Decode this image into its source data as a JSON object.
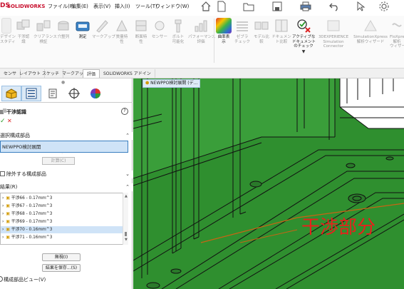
{
  "app": {
    "brand": "DS",
    "name": "SOLIDWORKS"
  },
  "menu": [
    "ファイル(F)",
    "編集(E)",
    "表示(V)",
    "挿入(I)",
    "ツール(T)",
    "ウィンドウ(W)"
  ],
  "ribbon": {
    "left_buttons": [
      {
        "label": "デザイン\nスタディ"
      },
      {
        "label": "干渉認\n識"
      },
      {
        "label": "クリアランス\n検証"
      },
      {
        "label": "穴整列"
      },
      {
        "label": "測定"
      },
      {
        "label": "マークアップ"
      },
      {
        "label": "質量特\n性"
      },
      {
        "label": "断面特\n性"
      },
      {
        "label": "センサー"
      },
      {
        "label": "ボルト\n可能化"
      },
      {
        "label": "パフォーマンス\n評価"
      }
    ],
    "right_buttons": [
      {
        "label": "曲率表\n示"
      },
      {
        "label": "ゼブラ\nチェック"
      },
      {
        "label": "モデル比\n較"
      },
      {
        "label": "ドキュメン\nト比較"
      },
      {
        "label": "アクティブな\nドキュメント\nのチェック"
      },
      {
        "label": "3DEXPERIENCE\nSimulation\nConnector"
      },
      {
        "label": "SimulationXpress\n解析ウィザード"
      },
      {
        "label": "FloXpress\n解析\nウィザード"
      }
    ]
  },
  "tabs": [
    "センサ",
    "レイアウト",
    "スケッチ",
    "マークアップ",
    "評価",
    "SOLIDWORKS アドイン"
  ],
  "active_tab": "評価",
  "panel": {
    "title": "干渉認識",
    "help": "?",
    "ok": "✓",
    "cancel": "✕",
    "selected_section": "選択構成部品",
    "selected_value": "NEWPPO検討展開",
    "calc_button": "計算(C)",
    "excluded_section": "除外する構成部品",
    "results_section": "結果(R)",
    "results": [
      {
        "label": "干渉66 - 0.17mm^3",
        "highlighted": false
      },
      {
        "label": "干渉67 - 0.17mm^3",
        "highlighted": false
      },
      {
        "label": "干渉68 - 0.17mm^3",
        "highlighted": false
      },
      {
        "label": "干渉69 - 0.17mm^3",
        "highlighted": false
      },
      {
        "label": "干渉70 - 0.16mm^3",
        "highlighted": true
      },
      {
        "label": "干渉71 - 0.16mm^3",
        "highlighted": false
      }
    ],
    "ignore_button": "無視(I)",
    "save_button": "結果を保存...(S)",
    "component_view": "構成部品ビュー(V)"
  },
  "viewport": {
    "tree_label": "NEWPPO検討展開 (デ...",
    "annotation": "干渉部分",
    "annotation_color": "#e8201c",
    "model_color": "#2f8f2f"
  }
}
